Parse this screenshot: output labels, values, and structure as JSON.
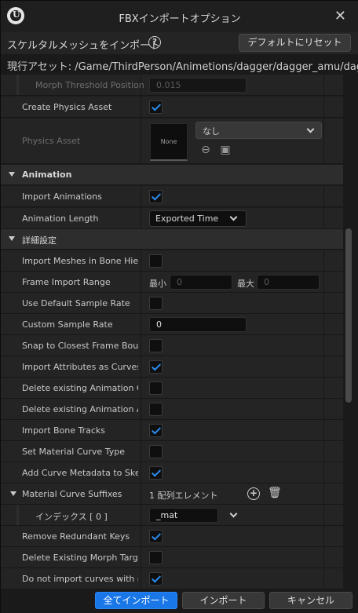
{
  "window": {
    "title": "FBXインポートオプション"
  },
  "header": {
    "label": "スケルタルメッシュをインポート",
    "reset_label": "デフォルトにリセット"
  },
  "asset_path": {
    "text": "現行アセット:  /Game/ThirdPerson/Animetions/dagger/dagger_amu/dagger_an"
  },
  "rows": {
    "morph_threshold": {
      "label": "Morph Threshold Position",
      "value": "0.015"
    },
    "create_physics": {
      "label": "Create Physics Asset",
      "checked": true
    },
    "physics_asset": {
      "label": "Physics Asset",
      "thumb": "None",
      "value": "なし"
    },
    "animation_cat": {
      "label": "Animation"
    },
    "import_animations": {
      "label": "Import Animations",
      "checked": true
    },
    "animation_length": {
      "label": "Animation Length",
      "value": "Exported Time"
    },
    "advanced_cat": {
      "label": "詳細設定"
    },
    "import_meshes_bone": {
      "label": "Import Meshes in Bone Hier…",
      "checked": false
    },
    "frame_import_range": {
      "label": "Frame Import Range",
      "min_label": "最小",
      "min_value": "0",
      "max_label": "最大",
      "max_value": "0"
    },
    "use_default_sample": {
      "label": "Use Default Sample Rate",
      "checked": false
    },
    "custom_sample_rate": {
      "label": "Custom Sample Rate",
      "value": "0"
    },
    "snap_closest": {
      "label": "Snap to Closest Frame Bou…",
      "checked": false
    },
    "import_attributes": {
      "label": "Import Attributes as Curves…",
      "checked": true
    },
    "delete_existing_c": {
      "label": "Delete existing Animation C…",
      "checked": false
    },
    "delete_existing_a": {
      "label": "Delete existing Animation A…",
      "checked": false
    },
    "import_bone_tracks": {
      "label": "Import Bone Tracks",
      "checked": true
    },
    "set_material_curve": {
      "label": "Set Material Curve Type",
      "checked": false
    },
    "add_curve_metadata": {
      "label": "Add Curve Metadata to Skel…",
      "checked": true
    },
    "material_curve_suffixes": {
      "label": "Material Curve Suffixes",
      "value": "1 配列エレメント"
    },
    "index0": {
      "label": "インデックス [ 0 ]",
      "value": "_mat"
    },
    "remove_redundant": {
      "label": "Remove Redundant Keys",
      "checked": true
    },
    "delete_morph": {
      "label": "Delete Existing Morph Targ…",
      "checked": false
    },
    "do_not_import": {
      "label": "Do not import curves with o…",
      "checked": true
    }
  },
  "footer": {
    "import_all": "全てインポート",
    "import": "インポート",
    "cancel": "キャンセル"
  },
  "colors": {
    "accent": "#1a77e8",
    "check": "#2a8cf0",
    "row_bg": "#242424",
    "category_bg": "#2d2d2d"
  }
}
